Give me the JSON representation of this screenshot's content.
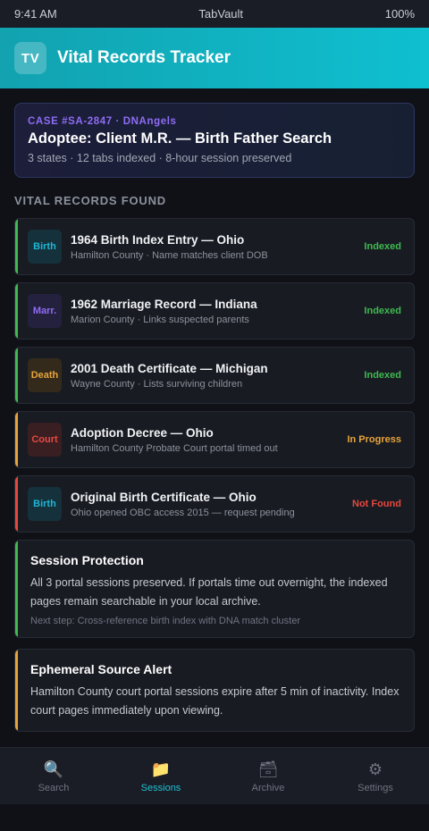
{
  "status_bar": {
    "time": "9:41 AM",
    "app": "TabVault",
    "battery": "100%"
  },
  "header": {
    "logo": "TV",
    "title": "Vital Records Tracker"
  },
  "case": {
    "id": "CASE #SA-2847 · DNAngels",
    "title": "Adoptee: Client M.R. — Birth Father Search",
    "meta": "3 states · 12 tabs indexed · 8-hour session preserved"
  },
  "section_label": "VITAL RECORDS FOUND",
  "records": [
    {
      "tag": "Birth",
      "title": "1964 Birth Index Entry — Ohio",
      "sub": "Hamilton County · Name matches client DOB",
      "status": "Indexed",
      "accent": "#3fb950",
      "tag_color": "#1fb6d6",
      "tag_bg": "#15313b",
      "status_color": "#3fb950"
    },
    {
      "tag": "Marr.",
      "title": "1962 Marriage Record — Indiana",
      "sub": "Marion County · Links suspected parents",
      "status": "Indexed",
      "accent": "#3fb950",
      "tag_color": "#8f6cf5",
      "tag_bg": "#24213f",
      "status_color": "#3fb950"
    },
    {
      "tag": "Death",
      "title": "2001 Death Certificate — Michigan",
      "sub": "Wayne County · Lists surviving children",
      "status": "Indexed",
      "accent": "#3fb950",
      "tag_color": "#e7a33c",
      "tag_bg": "#332a1c",
      "status_color": "#3fb950"
    },
    {
      "tag": "Court",
      "title": "Adoption Decree — Ohio",
      "sub": "Hamilton County Probate Court portal timed out",
      "status": "In Progress",
      "accent": "#e7a33c",
      "tag_color": "#e5483f",
      "tag_bg": "#3a1f22",
      "status_color": "#e7a33c"
    },
    {
      "tag": "Birth",
      "title": "Original Birth Certificate — Ohio",
      "sub": "Ohio opened OBC access 2015 — request pending",
      "status": "Not Found",
      "accent": "#e5483f",
      "tag_color": "#1fb6d6",
      "tag_bg": "#15313b",
      "status_color": "#e5483f"
    }
  ],
  "session_protection": {
    "title": "Session Protection",
    "body": "All 3 portal sessions preserved. If portals time out overnight, the indexed pages remain searchable in your local archive.",
    "note": "Next step: Cross-reference birth index with DNA match cluster",
    "accent": "#3fb950"
  },
  "alert": {
    "title": "Ephemeral Source Alert",
    "body": "Hamilton County court portal sessions expire after 5 min of inactivity. Index court pages immediately upon viewing.",
    "accent": "#e7a33c"
  },
  "tabs": [
    {
      "label": "Search",
      "icon": "magnifier-icon",
      "glyph": "🔍",
      "active": false
    },
    {
      "label": "Sessions",
      "icon": "folder-icon",
      "glyph": "📁",
      "active": true
    },
    {
      "label": "Archive",
      "icon": "archive-box-icon",
      "glyph": "🗃",
      "active": false
    },
    {
      "label": "Settings",
      "icon": "gear-icon",
      "glyph": "⚙",
      "active": false
    }
  ]
}
